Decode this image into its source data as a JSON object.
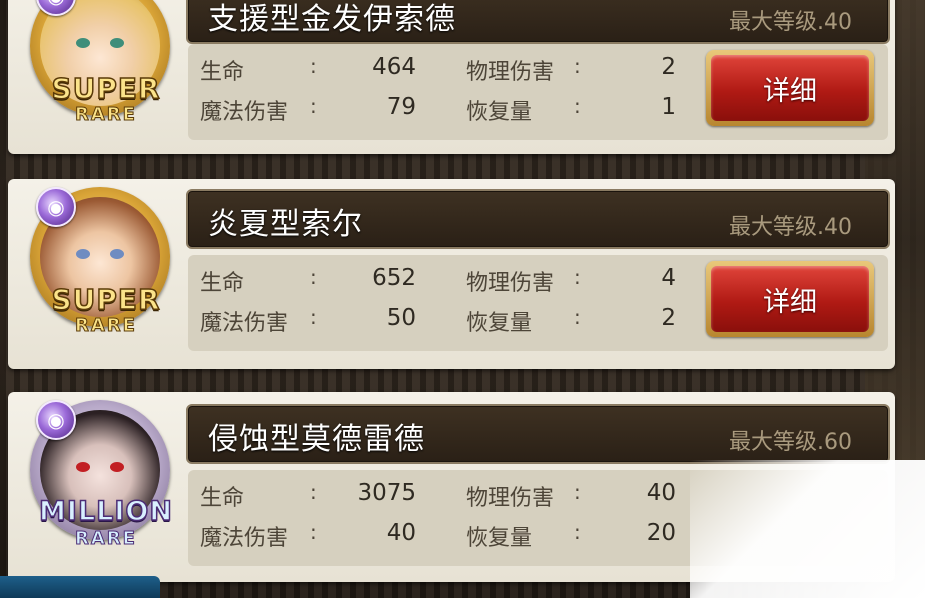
{
  "colors": {
    "namebar_bg": "#2a2016",
    "stats_bg": "#d6d0bf",
    "detail_button": "#b01a14",
    "max_level_text": "#a99a7e"
  },
  "units": [
    {
      "name": "支援型金发伊索德",
      "max_level": "最大等级.40",
      "rarity_top": "SUPER",
      "rarity_bottom": "RARE",
      "element_icon": "dark-element-icon",
      "stats": {
        "hp_label": "生命",
        "hp_colon": ":",
        "hp": "464",
        "phys_label": "物理伤害",
        "phys_colon": ":",
        "phys": "2",
        "magic_label": "魔法伤害",
        "magic_colon": ":",
        "magic": "79",
        "recovery_label": "恢复量",
        "recovery_colon": ":",
        "recovery": "1"
      },
      "detail_label": "详细"
    },
    {
      "name": "炎夏型索尔",
      "max_level": "最大等级.40",
      "rarity_top": "SUPER",
      "rarity_bottom": "RARE",
      "element_icon": "dark-element-icon",
      "stats": {
        "hp_label": "生命",
        "hp_colon": ":",
        "hp": "652",
        "phys_label": "物理伤害",
        "phys_colon": ":",
        "phys": "4",
        "magic_label": "魔法伤害",
        "magic_colon": ":",
        "magic": "50",
        "recovery_label": "恢复量",
        "recovery_colon": ":",
        "recovery": "2"
      },
      "detail_label": "详细"
    },
    {
      "name": "侵蚀型莫德雷德",
      "max_level": "最大等级.60",
      "rarity_top": "MILLION",
      "rarity_bottom": "RARE",
      "element_icon": "dark-element-icon",
      "stats": {
        "hp_label": "生命",
        "hp_colon": ":",
        "hp": "3075",
        "phys_label": "物理伤害",
        "phys_colon": ":",
        "phys": "40",
        "magic_label": "魔法伤害",
        "magic_colon": ":",
        "magic": "40",
        "recovery_label": "恢复量",
        "recovery_colon": ":",
        "recovery": "20"
      }
    }
  ]
}
